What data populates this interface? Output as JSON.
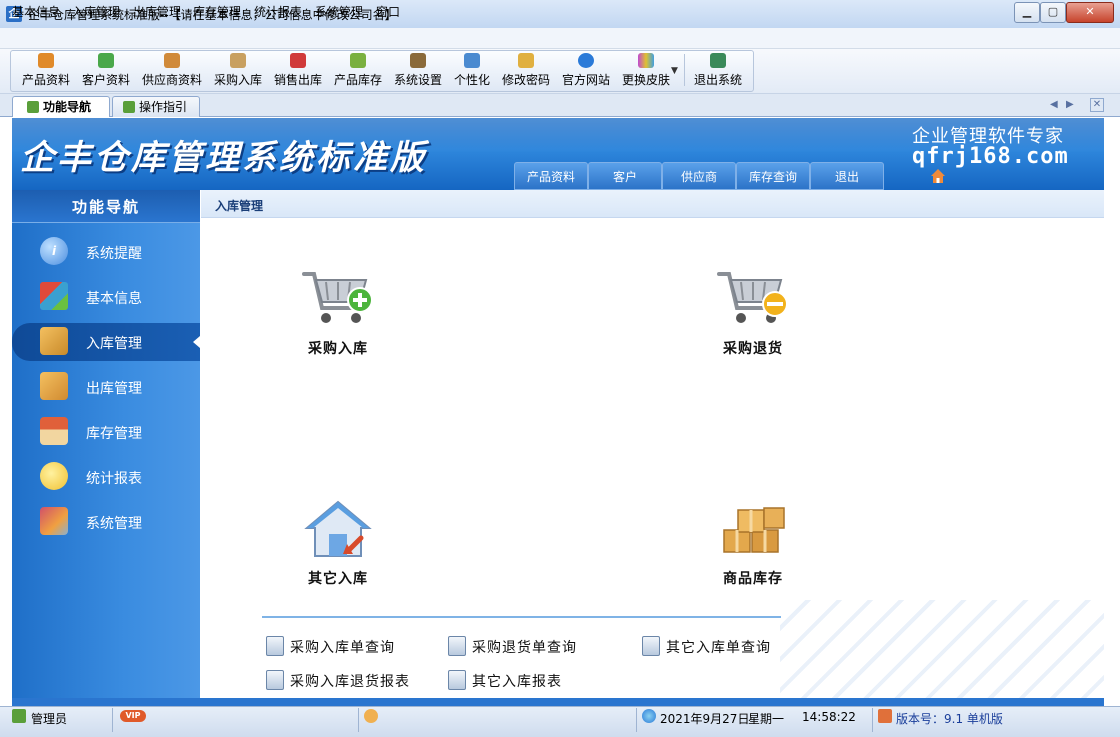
{
  "window": {
    "title": "企丰仓库管理系统标准版--【请在基本信息，公司信息中修改公司名】",
    "min_glyph": "▁",
    "max_glyph": "▢",
    "close_glyph": "✕"
  },
  "menu": [
    "基本信息",
    "入库管理",
    "出库管理",
    "库存管理",
    "统计报表",
    "系统管理",
    "窗口"
  ],
  "toolbar": [
    {
      "label": "产品资料",
      "icon": "product-icon",
      "color": "#e08a2a"
    },
    {
      "label": "客户资料",
      "icon": "customer-icon",
      "color": "#4aa84a"
    },
    {
      "label": "供应商资料",
      "icon": "supplier-icon",
      "color": "#d08a3a"
    },
    {
      "label": "采购入库",
      "icon": "purchase-icon",
      "color": "#c8a060"
    },
    {
      "label": "销售出库",
      "icon": "sales-icon",
      "color": "#d03a3a"
    },
    {
      "label": "产品库存",
      "icon": "inventory-icon",
      "color": "#7ab040"
    },
    {
      "label": "系统设置",
      "icon": "settings-icon",
      "color": "#8a6a3a"
    },
    {
      "label": "个性化",
      "icon": "personalize-icon",
      "color": "#4a8ad0"
    },
    {
      "label": "修改密码",
      "icon": "password-icon",
      "color": "#e0b040"
    },
    {
      "label": "官方网站",
      "icon": "ie-icon",
      "color": "#2a7ad8"
    },
    {
      "label": "更换皮肤",
      "icon": "skin-icon",
      "color": "#c04ad0"
    },
    {
      "label": "退出系统",
      "icon": "exit-icon",
      "color": "#3a8a5a"
    }
  ],
  "tabs": [
    {
      "label": "功能导航",
      "active": true
    },
    {
      "label": "操作指引",
      "active": false
    }
  ],
  "tab_controls": {
    "prev": "◀",
    "next": "▶",
    "close": "✕"
  },
  "banner": {
    "title": "企丰仓库管理系统标准版",
    "nav": [
      "产品资料",
      "客户",
      "供应商",
      "库存查询",
      "退出"
    ],
    "slogan": "企业管理软件专家",
    "website": "qfrj168.com"
  },
  "sidebar": {
    "title": "功能导航",
    "items": [
      {
        "label": "系统提醒",
        "icon": "info-icon",
        "color": "#4a8ee0"
      },
      {
        "label": "基本信息",
        "icon": "cubes-icon",
        "color": "#e04a3a"
      },
      {
        "label": "入库管理",
        "icon": "stock-in-box-icon",
        "color": "#e0a040",
        "active": true
      },
      {
        "label": "出库管理",
        "icon": "stock-out-box-icon",
        "color": "#e09a3a"
      },
      {
        "label": "库存管理",
        "icon": "warehouse-house-icon",
        "color": "#e0703a"
      },
      {
        "label": "统计报表",
        "icon": "chat-bubbles-icon",
        "color": "#f0c030"
      },
      {
        "label": "系统管理",
        "icon": "tools-icon",
        "color": "#d0506a"
      }
    ]
  },
  "main": {
    "breadcrumb": "入库管理",
    "modules": [
      {
        "label": "采购入库",
        "icon": "cart-add-icon"
      },
      {
        "label": "采购退货",
        "icon": "cart-remove-icon"
      },
      {
        "label": "其它入库",
        "icon": "house-in-icon"
      },
      {
        "label": "商品库存",
        "icon": "boxes-icon"
      }
    ],
    "links": [
      "采购入库单查询",
      "采购退货单查询",
      "其它入库单查询",
      "采购入库退货报表",
      "其它入库报表"
    ]
  },
  "statusbar": {
    "user": "管理员",
    "vip": "VIP",
    "date": "2021年9月27日",
    "weekday": "星期一",
    "time": "14:58:22",
    "version": "版本号：9.1 单机版"
  },
  "colors": {
    "accent": "#2a75cf",
    "sidebar_active": "#0f4a97",
    "link_blue": "#1a3e78"
  }
}
